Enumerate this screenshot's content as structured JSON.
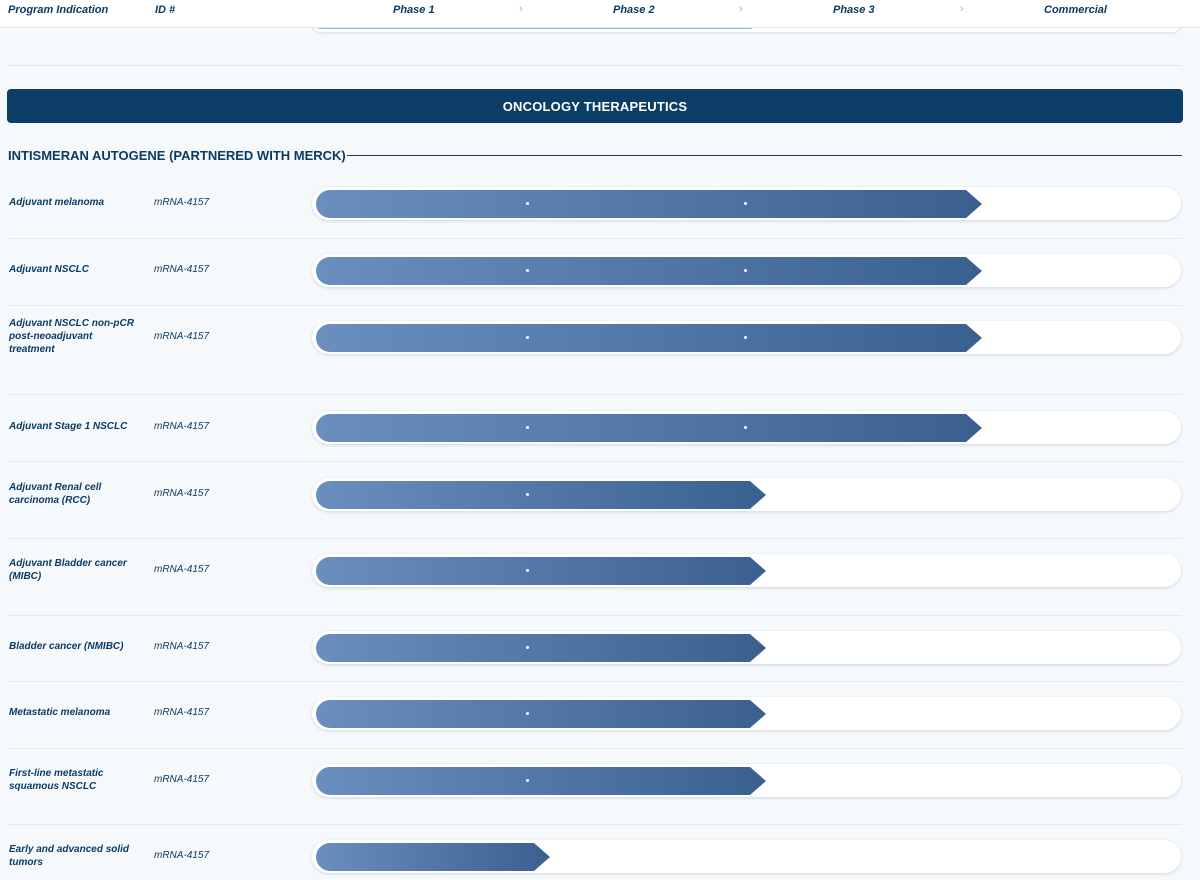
{
  "header": {
    "program_indication": "Program Indication",
    "id": "ID #",
    "phase1": "Phase 1",
    "phase2": "Phase 2",
    "phase3": "Phase 3",
    "commercial": "Commercial",
    "separator_icon": "chevron-right-icon"
  },
  "banner": {
    "title": "ONCOLOGY THERAPEUTICS"
  },
  "program": {
    "title": "INTISMERAN AUTOGENE (PARTNERED WITH MERCK)"
  },
  "stages": [
    "Phase 1",
    "Phase 2",
    "Phase 3",
    "Commercial"
  ],
  "colors": {
    "navy": "#0b3d66",
    "fill_start": "#6a8fbe",
    "fill_end": "#3a6090",
    "track": "#ffffff",
    "background": "#f6f9fc"
  },
  "rows": [
    {
      "indication": "Adjuvant melanoma",
      "id": "mRNA-4157",
      "stage": "Phase 3"
    },
    {
      "indication": "Adjuvant NSCLC",
      "id": "mRNA-4157",
      "stage": "Phase 3"
    },
    {
      "indication": "Adjuvant NSCLC non-pCR post-neoadjuvant treatment",
      "id": "mRNA-4157",
      "stage": "Phase 3"
    },
    {
      "indication": "Adjuvant Stage 1 NSCLC",
      "id": "mRNA-4157",
      "stage": "Phase 3"
    },
    {
      "indication": "Adjuvant Renal cell carcinoma (RCC)",
      "id": "mRNA-4157",
      "stage": "Phase 2"
    },
    {
      "indication": "Adjuvant Bladder cancer (MIBC)",
      "id": "mRNA-4157",
      "stage": "Phase 2"
    },
    {
      "indication": "Bladder cancer (NMIBC)",
      "id": "mRNA-4157",
      "stage": "Phase 2"
    },
    {
      "indication": "Metastatic melanoma",
      "id": "mRNA-4157",
      "stage": "Phase 2"
    },
    {
      "indication": "First-line metastatic squamous NSCLC",
      "id": "mRNA-4157",
      "stage": "Phase 2"
    },
    {
      "indication": "Early and advanced solid tumors",
      "id": "mRNA-4157",
      "stage": "Phase 1"
    }
  ]
}
